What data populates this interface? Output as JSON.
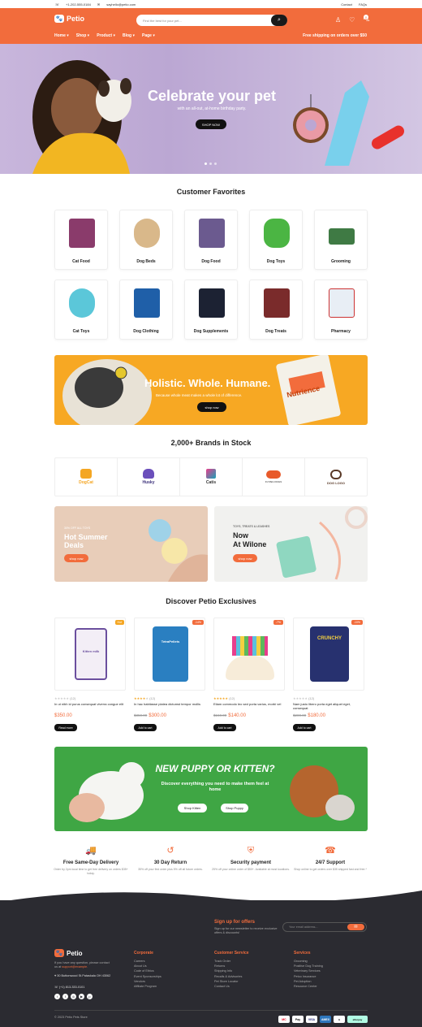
{
  "topbar": {
    "phone": "+1-202-555-0184",
    "email": "sayhello@petio.com",
    "contact": "Contact",
    "faqs": "FAQs"
  },
  "header": {
    "logo": "Petio",
    "search_placeholder": "Find the best for your pet...",
    "cart_count": "0",
    "nav": [
      "Home ▾",
      "Shop ▾",
      "Product ▾",
      "Blog ▾",
      "Page ▾"
    ],
    "shipping_note": "Free shipping on orders over $50"
  },
  "hero": {
    "title": "Celebrate your pet",
    "subtitle": "with an all-out, at-home birthday party.",
    "button": "SHOP NOW"
  },
  "favorites": {
    "title": "Customer Favorites",
    "items": [
      "Cat Food",
      "Dog Beds",
      "Dog Food",
      "Dog Toys",
      "Grooming",
      "Cat Toys",
      "Dog Clothing",
      "Dog Supplements",
      "Dog Treats",
      "Pharmacy"
    ]
  },
  "promo": {
    "title": "Holistic. Whole. Humane.",
    "subtitle": "Because whole meat makes a whole lot of difference.",
    "button": "shop now",
    "package_text": "Nutrience"
  },
  "brands": {
    "title": "2,000+ Brands in Stock",
    "items": [
      "DogCat",
      "Husky",
      "Catis",
      "FLYING DOGS",
      "DOG LOGO"
    ]
  },
  "promo_left": {
    "small": "30% OFF ALL TOYS",
    "title_line1": "Hot Summer",
    "title_line2": "Deals",
    "button": "shop now"
  },
  "promo_right": {
    "small": "TOYS, TREATS & LEASHES",
    "title_line1": "Now",
    "title_line2": "At Wilone",
    "button": "shop now"
  },
  "exclusives": {
    "title": "Discover Petio Exclusives",
    "products": [
      {
        "badge": "Hot",
        "rating": "(12)",
        "title": "In ut nibh id purus consequat viverra congue elit",
        "old": "",
        "price": "$350.00",
        "button": "Read more",
        "image_text": "Kitten milk"
      },
      {
        "badge": "-14%",
        "rating": "(12)",
        "title": "In hac habitasse platea dictumst tempor mollis",
        "old": "$350.00",
        "price": "$300.00",
        "button": "Add to cart",
        "image_text": "TetraPellets"
      },
      {
        "badge": "-7%",
        "rating": "(12)",
        "title": "Etiam commodo leo sed porta varius, morbi vel",
        "old": "$150.00",
        "price": "$140.00",
        "button": "Add to cart",
        "image_text": ""
      },
      {
        "badge": "-10%",
        "rating": "(12)",
        "title": "Nam justo libero porta eget aliquet eget, consequat",
        "old": "$200.00",
        "price": "$180.00",
        "button": "Add to cart",
        "image_text": "CRUNCHY"
      }
    ]
  },
  "green_banner": {
    "title": "NEW PUPPY OR KITTEN?",
    "subtitle": "Discover everything you need to make them feel at home",
    "btn1": "Shop Kitten",
    "btn2": "Shop Puppy"
  },
  "features": [
    {
      "icon": "🚚",
      "title": "Free Same-Day Delivery",
      "desc": "Order by 2pm local time to get free delivery on orders $35+ today."
    },
    {
      "icon": "↺",
      "title": "30 Day Return",
      "desc": "35% off your first order plus 5% off all future orders."
    },
    {
      "icon": "⛨",
      "title": "Security payment",
      "desc": "25% off your online order of $50+. Available at most locations."
    },
    {
      "icon": "☎",
      "title": "24/7 Support",
      "desc": "Shop online to get orders over $35 shipped fast and free.*"
    }
  ],
  "newsletter": {
    "title": "Sign up for offers",
    "desc": "Sign up for our newsletter to receive exclusive offers & discounts!",
    "placeholder": "Your email address..."
  },
  "footer": {
    "logo": "Petio",
    "about": "If you have any question, please contact us at",
    "email": "support@example.",
    "address": "30 Buttonwood St.Pataskala OH 43062",
    "phone": "(+1) 813-333-0101",
    "copyright": "© 2023 Petio Pets Store",
    "corporate": {
      "title": "Corporate",
      "links": [
        "Careers",
        "About Us",
        "Code of Ethics",
        "Event Sponsorships",
        "Vendors",
        "Affiliate Program"
      ]
    },
    "service": {
      "title": "Customer Service",
      "links": [
        "Track Order",
        "Returns",
        "Shipping Info",
        "Recalls & Advisories",
        "Pet Store Locator",
        "Contact Us"
      ]
    },
    "services": {
      "title": "Services",
      "links": [
        "Grooming",
        "Positive Dog Training",
        "Veterinary Services",
        "Petco Insurance",
        "Pet Adoption",
        "Resource Center"
      ]
    },
    "payments": [
      "MC",
      "Pay",
      "VISA",
      "AMEX",
      "afterpay"
    ]
  },
  "colors": {
    "brand": "#f26c3c",
    "promo_yellow": "#f7a823",
    "green": "#3fa644",
    "footer": "#2b2b31"
  }
}
